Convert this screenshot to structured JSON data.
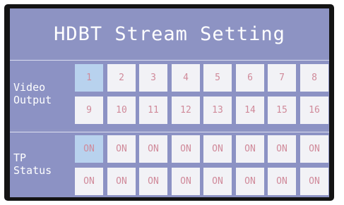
{
  "title": "HDBT Stream Setting",
  "video_output": {
    "label_line1": "Video",
    "label_line2": "Output",
    "row1": [
      "1",
      "2",
      "3",
      "4",
      "5",
      "6",
      "7",
      "8"
    ],
    "row2": [
      "9",
      "10",
      "11",
      "12",
      "13",
      "14",
      "15",
      "16"
    ],
    "selected": "1"
  },
  "tp_status": {
    "label_line1": "TP",
    "label_line2": "Status",
    "row1": [
      "ON",
      "ON",
      "ON",
      "ON",
      "ON",
      "ON",
      "ON",
      "ON"
    ],
    "row2": [
      "ON",
      "ON",
      "ON",
      "ON",
      "ON",
      "ON",
      "ON",
      "ON"
    ],
    "selected_index_row1": 0
  },
  "colors": {
    "screen_background": "#8e94c4",
    "cell_background": "#f2f2f6",
    "cell_selected": "#b8d2ee",
    "cell_text": "#d08a9a",
    "label_text": "#ffffff"
  }
}
